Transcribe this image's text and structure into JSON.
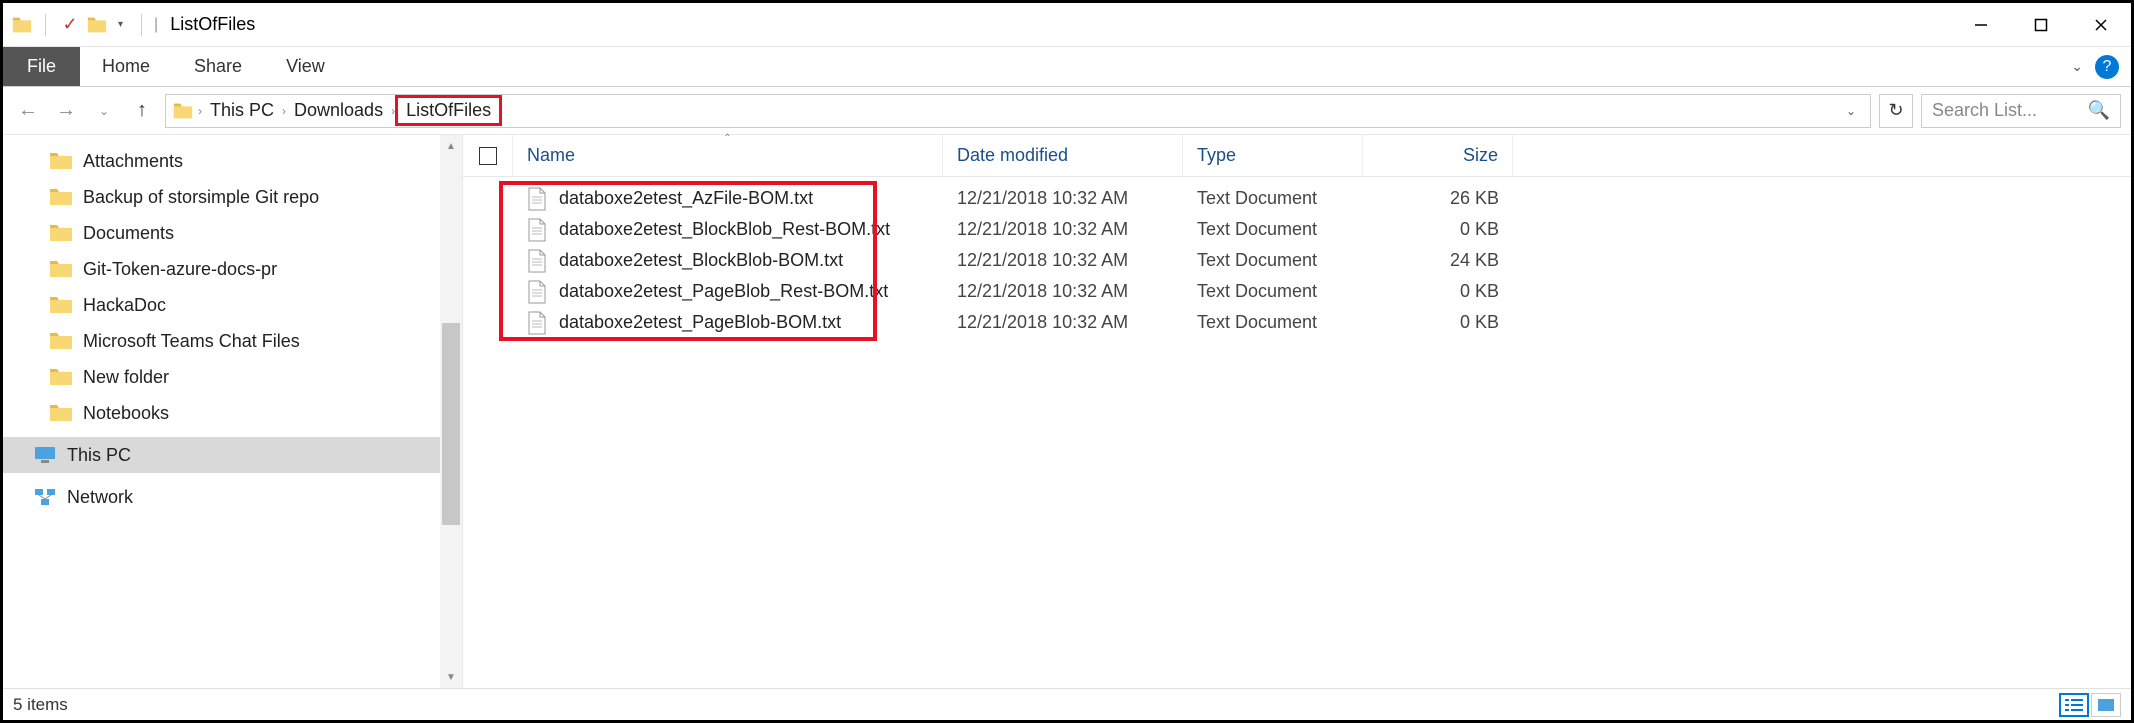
{
  "window": {
    "title": "ListOfFiles"
  },
  "ribbon": {
    "file": "File",
    "tabs": [
      "Home",
      "Share",
      "View"
    ]
  },
  "breadcrumbs": [
    "This PC",
    "Downloads",
    "ListOfFiles"
  ],
  "search": {
    "placeholder": "Search List..."
  },
  "sidebar": {
    "items": [
      "Attachments",
      "Backup of storsimple Git repo",
      "Documents",
      "Git-Token-azure-docs-pr",
      "HackaDoc",
      "Microsoft Teams Chat Files",
      "New folder",
      "Notebooks"
    ],
    "this_pc": "This PC",
    "network": "Network"
  },
  "columns": {
    "name": "Name",
    "date": "Date modified",
    "type": "Type",
    "size": "Size"
  },
  "files": [
    {
      "name": "databoxe2etest_AzFile-BOM.txt",
      "date": "12/21/2018 10:32 AM",
      "type": "Text Document",
      "size": "26 KB"
    },
    {
      "name": "databoxe2etest_BlockBlob_Rest-BOM.txt",
      "date": "12/21/2018 10:32 AM",
      "type": "Text Document",
      "size": "0 KB"
    },
    {
      "name": "databoxe2etest_BlockBlob-BOM.txt",
      "date": "12/21/2018 10:32 AM",
      "type": "Text Document",
      "size": "24 KB"
    },
    {
      "name": "databoxe2etest_PageBlob_Rest-BOM.txt",
      "date": "12/21/2018 10:32 AM",
      "type": "Text Document",
      "size": "0 KB"
    },
    {
      "name": "databoxe2etest_PageBlob-BOM.txt",
      "date": "12/21/2018 10:32 AM",
      "type": "Text Document",
      "size": "0 KB"
    }
  ],
  "status": {
    "text": "5 items"
  }
}
